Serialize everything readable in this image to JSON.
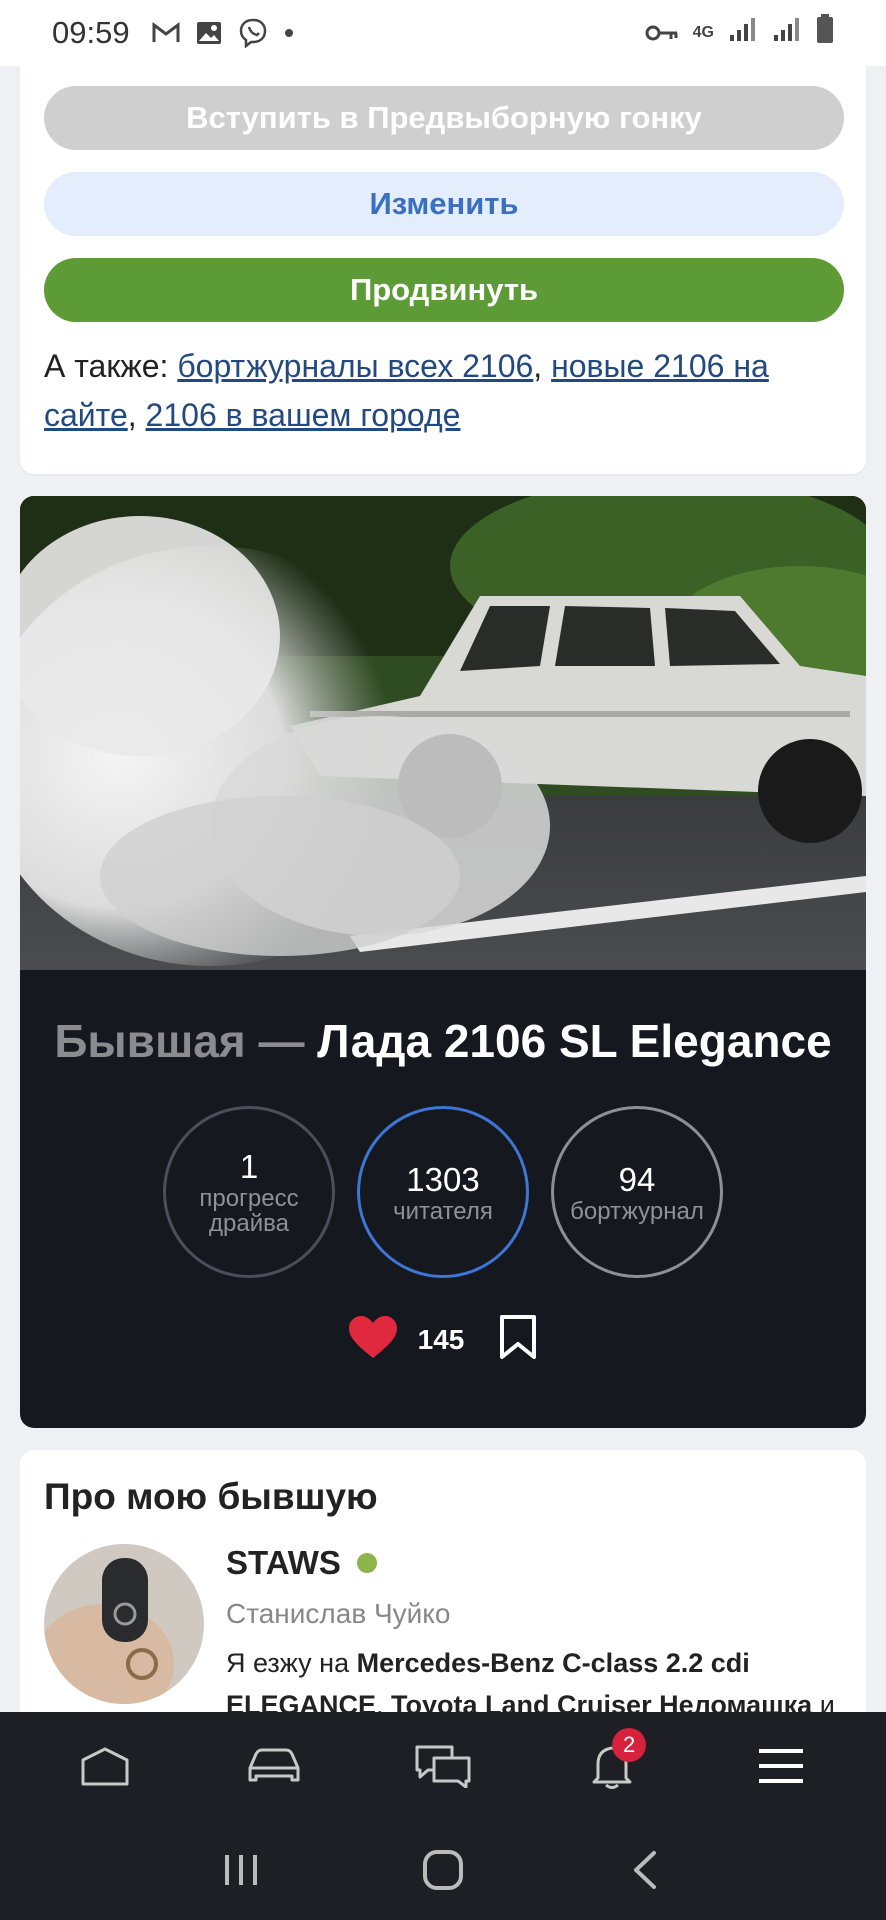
{
  "status_bar": {
    "time": "09:59",
    "network": "4G"
  },
  "actions": {
    "race_label": "Вступить в Предвыборную гонку",
    "edit_label": "Изменить",
    "promote_label": "Продвинуть"
  },
  "also": {
    "prefix": "А также: ",
    "links": [
      "бортжурналы всех 2106",
      "новые 2106 на сайте",
      "2106 в вашем городе"
    ]
  },
  "car": {
    "title_prefix": "Бывшая — ",
    "title_name": "Лада 2106 SL Elegance",
    "stats": [
      {
        "number": "1",
        "label_line1": "прогресс",
        "label_line2": "драйва"
      },
      {
        "number": "1303",
        "label_line1": "читателя",
        "label_line2": ""
      },
      {
        "number": "94",
        "label_line1": "бортжурнал",
        "label_line2": ""
      }
    ],
    "likes": "145"
  },
  "about": {
    "title": "Про мою бывшую",
    "username": "STAWS",
    "real_name": "Станислав Чуйко",
    "drives_prefix": "Я езжу на ",
    "car1": "Mercedes-Benz C-class 2.2 cdi ELEGANCE",
    "separator": ", ",
    "car2": "Toyota Land Cruiser Неломашка",
    "suffix": " и"
  },
  "bottom_nav": {
    "notifications_badge": "2"
  },
  "colors": {
    "promote": "#5c9b36",
    "edit_text": "#3b6fc2",
    "link": "#234a80",
    "active_ring": "#3d76d4",
    "badge": "#d6223d"
  }
}
